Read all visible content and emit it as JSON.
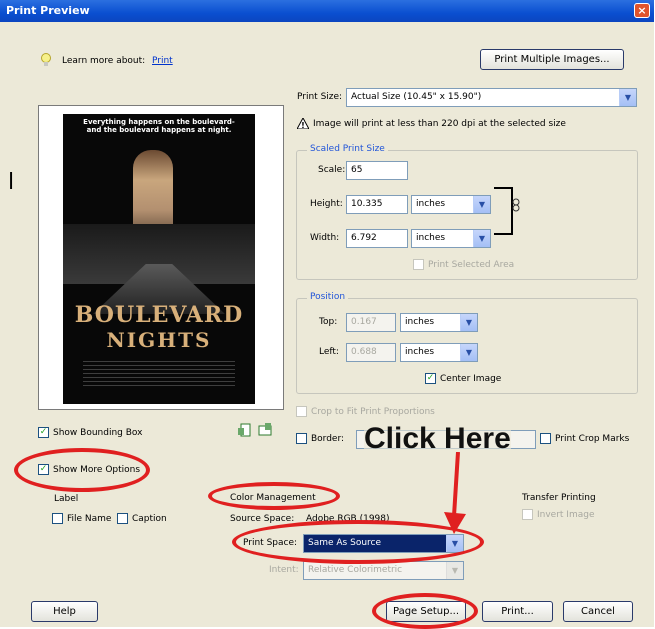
{
  "window": {
    "title": "Print Preview",
    "close": "×"
  },
  "learn_more": {
    "label": "Learn more about:",
    "link": "Print"
  },
  "buttons": {
    "print_multiple": "Print Multiple Images...",
    "help": "Help",
    "page_setup": "Page Setup...",
    "print": "Print...",
    "cancel": "Cancel"
  },
  "print_size": {
    "label": "Print Size:",
    "value": "Actual Size (10.45\" x 15.90\")"
  },
  "warning": "Image will print at less than 220 dpi at the selected size",
  "scaled_print_size": {
    "title": "Scaled Print Size",
    "scale_label": "Scale:",
    "scale_value": "65",
    "height_label": "Height:",
    "height_value": "10.335",
    "height_unit": "inches",
    "width_label": "Width:",
    "width_value": "6.792",
    "width_unit": "inches",
    "print_selected_area": "Print Selected Area"
  },
  "position": {
    "title": "Position",
    "top_label": "Top:",
    "top_value": "0.167",
    "top_unit": "inches",
    "left_label": "Left:",
    "left_value": "0.688",
    "left_unit": "inches",
    "center_image": "Center Image"
  },
  "crop_to_fit": "Crop to Fit Print Proportions",
  "border": {
    "label": "Border:"
  },
  "print_crop_marks": "Print Crop Marks",
  "show_bounding_box": "Show Bounding Box",
  "show_more_options": "Show More Options",
  "label_section": {
    "title": "Label",
    "file_name": "File Name",
    "caption": "Caption"
  },
  "color_management": {
    "title": "Color Management",
    "source_space_label": "Source Space:",
    "source_space_value": "Adobe RGB (1998)",
    "print_space_label": "Print Space:",
    "print_space_value": "Same As Source",
    "intent_label": "Intent:",
    "intent_value": "Relative Colorimetric"
  },
  "transfer": {
    "title": "Transfer Printing",
    "invert_image": "Invert Image"
  },
  "poster": {
    "tagline": "Everything happens on the boulevard-\nand the boulevard happens at night.",
    "title_line1": "BOULEVARD",
    "title_line2": "NIGHTS"
  },
  "annotation": {
    "text": "Click Here",
    "color": "#e02020"
  },
  "side_letter": "l",
  "colors": {
    "highlight": "#0a246a",
    "accent": "#2155d8",
    "check": "#21a121"
  }
}
